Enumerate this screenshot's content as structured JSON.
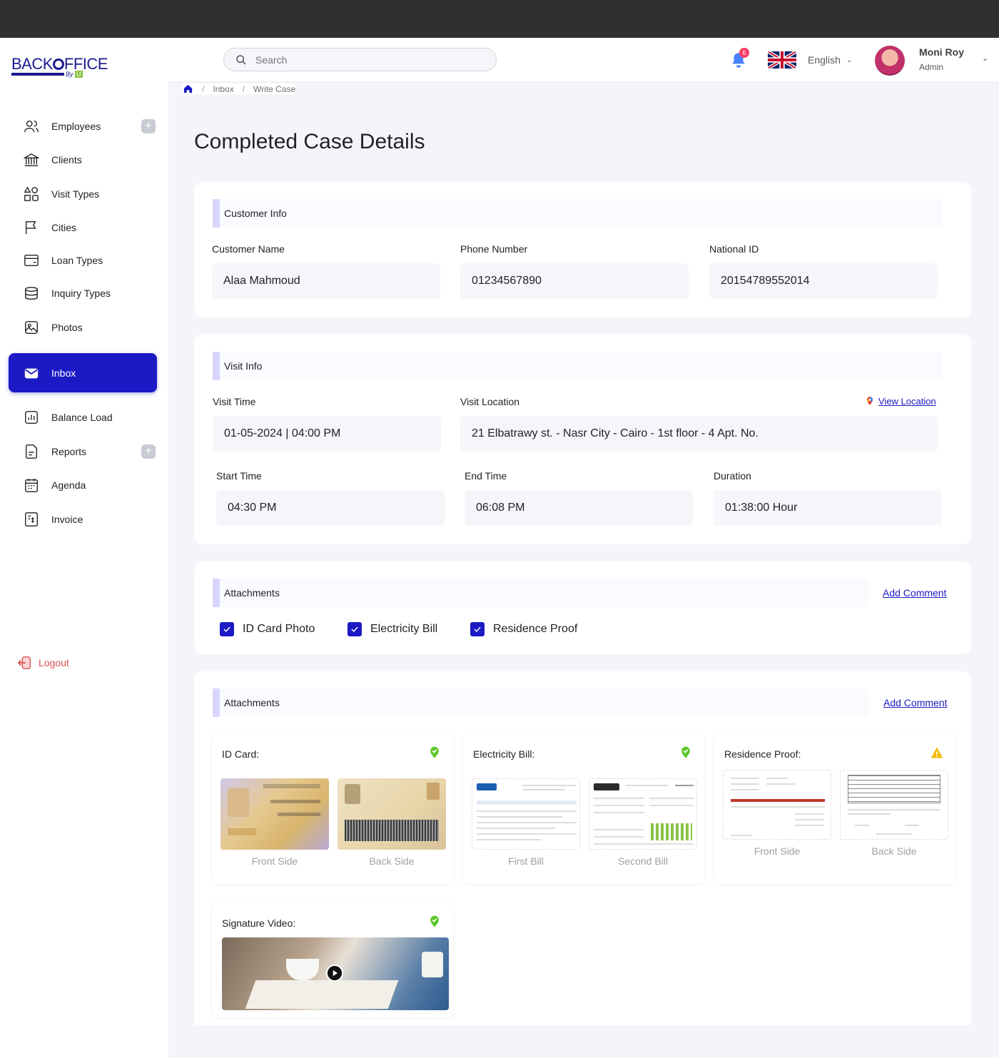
{
  "brand": {
    "name_part1": "BACK",
    "name_part2": "FFICE",
    "by": "By"
  },
  "search": {
    "placeholder": "Search"
  },
  "notifications": {
    "count": "6"
  },
  "language": {
    "label": "English"
  },
  "user": {
    "name": "Moni Roy",
    "role": "Admin"
  },
  "sidebar": {
    "items": [
      {
        "label": "Employees",
        "icon": "users-icon"
      },
      {
        "label": "Clients",
        "icon": "bank-icon"
      },
      {
        "label": "Visit Types",
        "icon": "shapes-icon"
      },
      {
        "label": "Cities",
        "icon": "flag-icon"
      },
      {
        "label": "Loan Types",
        "icon": "card-icon"
      },
      {
        "label": "Inquiry Types",
        "icon": "coins-icon"
      },
      {
        "label": "Photos",
        "icon": "image-icon"
      },
      {
        "label": "Inbox",
        "icon": "mail-icon"
      },
      {
        "label": "Balance Load",
        "icon": "chart-icon"
      },
      {
        "label": "Reports",
        "icon": "report-icon"
      },
      {
        "label": "Agenda",
        "icon": "calendar-icon"
      },
      {
        "label": "Invoice",
        "icon": "invoice-icon"
      }
    ],
    "plus": "+",
    "logout": "Logout"
  },
  "breadcrumb": {
    "items": [
      "Inbox",
      "Write Case"
    ],
    "sep": "/"
  },
  "page": {
    "title": "Completed Case Details"
  },
  "customer": {
    "header": "Customer Info",
    "name_label": "Customer Name",
    "name_value": "Alaa Mahmoud",
    "phone_label": "Phone Number",
    "phone_value": "01234567890",
    "nid_label": "National ID",
    "nid_value": "20154789552014"
  },
  "visit": {
    "header": "Visit Info",
    "time_label": "Visit Time",
    "time_value": "01-05-2024 | 04:00 PM",
    "location_label": "Visit Location",
    "location_value": "21 Elbatrawy st. - Nasr City - Cairo - 1st floor - 4 Apt. No.",
    "view_location": "View Location",
    "start_label": "Start Time",
    "start_value": "04:30 PM",
    "end_label": "End Time",
    "end_value": "06:08 PM",
    "duration_label": "Duration",
    "duration_value": "01:38:00 Hour"
  },
  "attachments_check": {
    "header": "Attachments",
    "add_comment": "Add Comment",
    "items": [
      "ID Card Photo",
      "Electricity Bill",
      "Residence Proof"
    ]
  },
  "attachments_files": {
    "header": "Attachments",
    "add_comment": "Add Comment",
    "id_card": {
      "title": "ID Card:",
      "front": "Front Side",
      "back": "Back Side",
      "status": "approved"
    },
    "electricity": {
      "title": "Electricity Bill:",
      "first": "First Bill",
      "second": "Second Bill",
      "status": "approved"
    },
    "residence": {
      "title": "Residence Proof:",
      "front": "Front Side",
      "back": "Back Side",
      "status": "warning"
    },
    "signature": {
      "title": "Signature Video:",
      "status": "approved"
    }
  },
  "colors": {
    "accent": "#1b1ac4",
    "approved": "#5cc72a",
    "warning": "#f5b900",
    "logout": "#d9534f"
  }
}
